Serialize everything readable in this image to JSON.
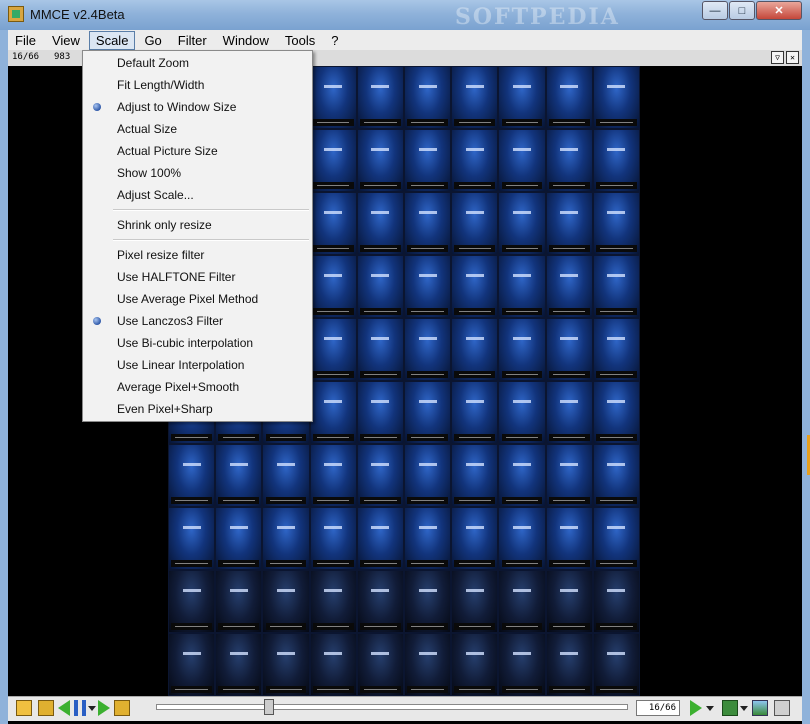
{
  "window": {
    "title": "MMCE v2.4Beta",
    "watermark": "SOFTPEDIA",
    "controls": {
      "minimize": "—",
      "maximize": "□",
      "close": "✕"
    }
  },
  "menubar": {
    "items": [
      {
        "label": "File"
      },
      {
        "label": "View"
      },
      {
        "label": "Scale"
      },
      {
        "label": "Go"
      },
      {
        "label": "Filter"
      },
      {
        "label": "Window"
      },
      {
        "label": "Tools"
      },
      {
        "label": "?"
      }
    ],
    "active": "Scale"
  },
  "infobar": {
    "counter": "16/66",
    "dimensions": "983"
  },
  "scale_menu": {
    "items": [
      {
        "label": "Default Zoom",
        "selected": false
      },
      {
        "label": "Fit Length/Width",
        "selected": false
      },
      {
        "label": "Adjust to Window Size",
        "selected": true
      },
      {
        "label": "Actual Size",
        "selected": false
      },
      {
        "label": "Actual Picture Size",
        "selected": false
      },
      {
        "label": "Show 100%",
        "selected": false
      },
      {
        "label": "Adjust Scale...",
        "selected": false
      },
      {
        "label": "Shrink only resize",
        "selected": false
      },
      {
        "label": "Pixel resize filter",
        "selected": false
      },
      {
        "label": "Use HALFTONE Filter",
        "selected": false
      },
      {
        "label": "Use Average Pixel Method",
        "selected": false
      },
      {
        "label": "Use Lanczos3 Filter",
        "selected": true
      },
      {
        "label": "Use Bi-cubic interpolation",
        "selected": false
      },
      {
        "label": "Use Linear Interpolation",
        "selected": false
      },
      {
        "label": "Average Pixel+Smooth",
        "selected": false
      },
      {
        "label": "Even Pixel+Sharp",
        "selected": false
      }
    ]
  },
  "statusbar": {
    "counter": "16/66",
    "slider_position": 0.24
  },
  "colors": {
    "titlebar": "#8fb2da",
    "menu_bg": "#f2f2f2",
    "radio": "#2e58a8",
    "thumbnail": "#12347c"
  }
}
